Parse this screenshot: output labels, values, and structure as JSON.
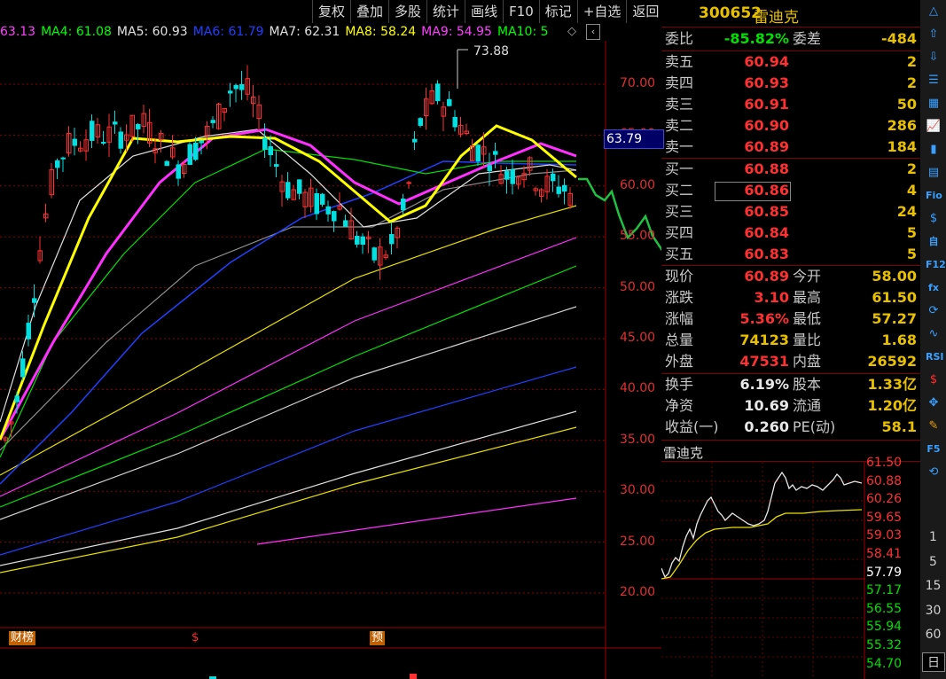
{
  "toolbar": [
    "复权",
    "叠加",
    "多股",
    "统计",
    "画线",
    "F10",
    "标记",
    "+自选",
    "返回"
  ],
  "ma_legend": [
    {
      "label": "63.13",
      "color": "#ff40ff"
    },
    {
      "label": "MA4: 61.08",
      "color": "#00ff00"
    },
    {
      "label": "MA5: 60.93",
      "color": "#e0e0e0"
    },
    {
      "label": "MA6: 61.79",
      "color": "#2040ff"
    },
    {
      "label": "MA7: 62.31",
      "color": "#e0e0e0"
    },
    {
      "label": "MA8: 58.24",
      "color": "#ffff00"
    },
    {
      "label": "MA9: 54.95",
      "color": "#ff40ff"
    },
    {
      "label": "MA10: 5",
      "color": "#00ff00"
    }
  ],
  "chart": {
    "high_label": "73.88",
    "current_price_box": "63.79",
    "y_ticks": [
      "70.00",
      "65.00",
      "60.00",
      "55.00",
      "50.00",
      "45.00",
      "40.00",
      "35.00",
      "30.00",
      "25.00",
      "20.00"
    ],
    "markers": [
      "财榜",
      "$",
      "预"
    ]
  },
  "stock": {
    "code": "300652",
    "name": "雷迪克"
  },
  "weibi": {
    "label1": "委比",
    "val1": "-85.82%",
    "label2": "委差",
    "val2": "-484"
  },
  "asks": [
    {
      "label": "卖五",
      "price": "60.94",
      "vol": "2"
    },
    {
      "label": "卖四",
      "price": "60.93",
      "vol": "2"
    },
    {
      "label": "卖三",
      "price": "60.91",
      "vol": "50"
    },
    {
      "label": "卖二",
      "price": "60.90",
      "vol": "286"
    },
    {
      "label": "卖一",
      "price": "60.89",
      "vol": "184"
    }
  ],
  "bids": [
    {
      "label": "买一",
      "price": "60.88",
      "vol": "2"
    },
    {
      "label": "买二",
      "price": "60.86",
      "vol": "4"
    },
    {
      "label": "买三",
      "price": "60.85",
      "vol": "24"
    },
    {
      "label": "买四",
      "price": "60.84",
      "vol": "5"
    },
    {
      "label": "买五",
      "price": "60.83",
      "vol": "5"
    }
  ],
  "quote1": [
    {
      "l1": "现价",
      "v1": "60.89",
      "c1": "red",
      "l2": "今开",
      "v2": "58.00",
      "c2": "red"
    },
    {
      "l1": "涨跌",
      "v1": "3.10",
      "c1": "red",
      "l2": "最高",
      "v2": "61.50",
      "c2": "red"
    },
    {
      "l1": "涨幅",
      "v1": "5.36%",
      "c1": "red",
      "l2": "最低",
      "v2": "57.27",
      "c2": "green"
    },
    {
      "l1": "总量",
      "v1": "74123",
      "c1": "yellow",
      "l2": "量比",
      "v2": "1.68",
      "c2": "red"
    },
    {
      "l1": "外盘",
      "v1": "47531",
      "c1": "red",
      "l2": "内盘",
      "v2": "26592",
      "c2": "green"
    }
  ],
  "quote2": [
    {
      "l1": "换手",
      "v1": "6.19%",
      "l2": "股本",
      "v2": "1.33亿"
    },
    {
      "l1": "净资",
      "v1": "10.69",
      "l2": "流通",
      "v2": "1.20亿"
    },
    {
      "l1": "收益(一)",
      "v1": "0.260",
      "l2": "PE(动)",
      "v2": "58.1"
    }
  ],
  "mini": {
    "title": "雷迪克",
    "ticks": [
      {
        "v": "61.50",
        "c": "red"
      },
      {
        "v": "60.88",
        "c": "red"
      },
      {
        "v": "60.26",
        "c": "red"
      },
      {
        "v": "59.65",
        "c": "red"
      },
      {
        "v": "59.03",
        "c": "red"
      },
      {
        "v": "58.41",
        "c": "red"
      },
      {
        "v": "57.79",
        "c": "white"
      },
      {
        "v": "57.17",
        "c": "green"
      },
      {
        "v": "56.55",
        "c": "green"
      },
      {
        "v": "55.94",
        "c": "green"
      },
      {
        "v": "55.32",
        "c": "green"
      },
      {
        "v": "54.70",
        "c": "green"
      }
    ]
  },
  "right_tools": {
    "icons": [
      "up-triangle-icon",
      "arrow-up-icon",
      "arrow-down-icon",
      "list-icon",
      "grid-icon",
      "trend-icon",
      "candle-icon",
      "doc-icon",
      "f10-icon",
      "dollar-doc-icon",
      "info-icon",
      "f12-icon",
      "fx-icon",
      "refresh-icon",
      "wave-icon",
      "rsi-icon",
      "dollar-icon",
      "move-icon",
      "pencil-icon",
      "f5-icon",
      "cycle-icon"
    ],
    "labels": {
      "rsi": "RSI",
      "f5": "F5",
      "fio": "Fio",
      "f12": "F12",
      "fx": "fx",
      "info": "自"
    },
    "periods": [
      "1",
      "5",
      "15",
      "30",
      "60",
      "日"
    ]
  }
}
